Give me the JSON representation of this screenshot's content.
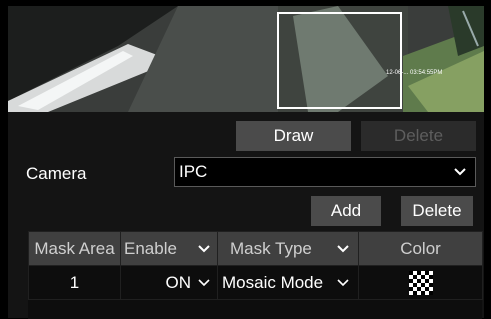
{
  "preview": {
    "timestamp_text": "12-06-... 03:54:55PM"
  },
  "toolbar": {
    "draw_label": "Draw",
    "delete_label": "Delete"
  },
  "camera": {
    "label": "Camera",
    "selected": "IPC"
  },
  "actions": {
    "add_label": "Add",
    "delete_label": "Delete"
  },
  "table": {
    "headers": {
      "mask_area": "Mask Area",
      "enable": "Enable",
      "mask_type": "Mask Type",
      "color": "Color"
    },
    "rows": [
      {
        "mask_area": "1",
        "enable": "ON",
        "mask_type": "Mosaic Mode",
        "color_icon": "mosaic-pattern-icon"
      }
    ]
  },
  "colors": {
    "button_bg": "#4b4b4b",
    "button_disabled_bg": "#2b2b2b",
    "header_bg": "#404040",
    "panel_bg": "#141414"
  }
}
